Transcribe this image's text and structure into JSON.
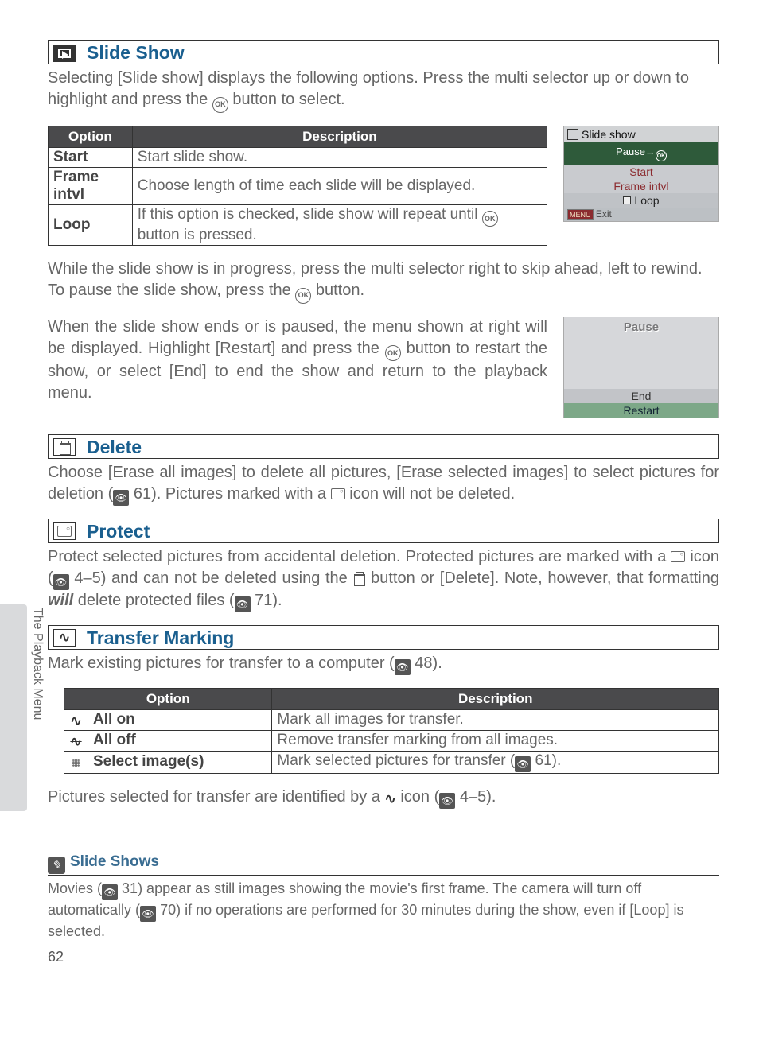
{
  "sections": {
    "slideShow": {
      "title": "Slide Show",
      "intro": "Selecting [Slide show] displays the following options.  Press the multi selector up or down to highlight and press the Ⓞ button to select.",
      "table": {
        "headers": [
          "Option",
          "Description"
        ],
        "rows": [
          {
            "opt": "Start",
            "desc": "Start slide show."
          },
          {
            "opt": "Frame intvl",
            "desc": "Choose length of time each slide will be displayed."
          },
          {
            "opt": "Loop",
            "desc": "If this option is checked, slide show will repeat until Ⓞ button is pressed."
          }
        ]
      },
      "screenshot1": {
        "title": "Slide show",
        "pause": "Pause→",
        "items": [
          "Start",
          "Frame intvl",
          "Loop"
        ],
        "exit": "Exit"
      },
      "para2": "While the slide show is in progress, press the multi selector right to skip ahead, left to rewind.  To pause the slide show, press the Ⓞ button.",
      "para3": "When the slide show ends or is paused, the menu shown at right will be displayed.  Highlight [Restart] and press the Ⓞ button to restart the show, or select [End] to end the show and return to the playback menu.",
      "screenshot2": {
        "title": "Pause",
        "end": "End",
        "restart": "Restart"
      }
    },
    "delete": {
      "title": "Delete",
      "body_a": "Choose [Erase all images] to delete all pictures, [Erase selected images] to select pictures for deletion (",
      "body_ref": "61",
      "body_b": ").  Pictures marked with a ",
      "body_c": " icon will not be deleted."
    },
    "protect": {
      "title": "Protect",
      "body_a": "Protect selected pictures from accidental deletion.  Protected pictures are marked with a ",
      "body_b": " icon (",
      "ref1": "4–5",
      "body_c": ") and can not be deleted using the ",
      "body_d": " button or [Delete].  Note, however, that formatting ",
      "will": "will",
      "body_e": " delete protected files (",
      "ref2": "71",
      "body_f": ")."
    },
    "transfer": {
      "title": "Transfer Marking",
      "intro_a": "Mark existing pictures for transfer to a computer (",
      "intro_ref": "48",
      "intro_b": ").",
      "table": {
        "headers": [
          "Option",
          "Description"
        ],
        "rows": [
          {
            "opt": "All on",
            "desc": "Mark all images for transfer."
          },
          {
            "opt": "All off",
            "desc": "Remove transfer marking from all images."
          },
          {
            "opt": "Select image(s)",
            "desc_a": "Mark selected pictures for transfer (",
            "desc_ref": "61",
            "desc_b": ")."
          }
        ]
      },
      "footer_a": "Pictures selected for transfer are identified by a ",
      "footer_b": " icon (",
      "footer_ref": "4–5",
      "footer_c": ")."
    },
    "note": {
      "title": "Slide Shows",
      "body_a": "Movies (",
      "ref1": "31",
      "body_b": ") appear as still images showing the movie's first frame.  The camera will turn off automatically (",
      "ref2": "70",
      "body_c": ") if no operations are performed for 30 minutes during the show, even if [Loop] is selected."
    }
  },
  "sideTab": "The Playback Menu",
  "pageNumber": "62",
  "icons": {
    "ok": "OK",
    "menu": "MENU"
  }
}
